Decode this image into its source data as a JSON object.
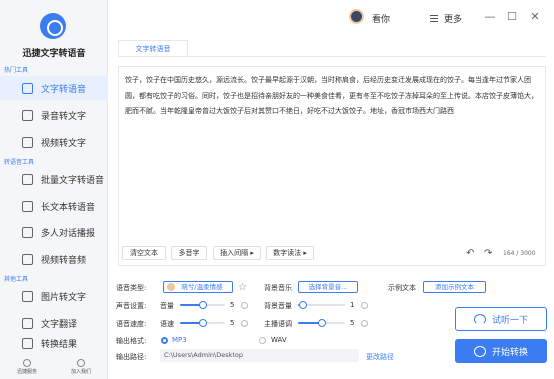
{
  "app": {
    "name": "迅捷文字转语音"
  },
  "sidebar": {
    "groups": [
      {
        "label": "热门工具"
      },
      {
        "label": "转语音工具"
      },
      {
        "label": "其他工具"
      }
    ],
    "items": [
      {
        "label": "文字转语音"
      },
      {
        "label": "录音转文字"
      },
      {
        "label": "视频转文字"
      },
      {
        "label": "批量文字转语音"
      },
      {
        "label": "长文本转语音"
      },
      {
        "label": "多人对话播报"
      },
      {
        "label": "视频转音频"
      },
      {
        "label": "图片转文字"
      },
      {
        "label": "文字翻译"
      },
      {
        "label": "转换结果"
      }
    ],
    "bottom": [
      {
        "label": "迅捷服务"
      },
      {
        "label": "加入我们"
      }
    ]
  },
  "header": {
    "username": "看你",
    "more_label": "更多"
  },
  "editor": {
    "tab": "文字转语音",
    "text": "饺子，饺子在中国历史悠久，源远流长。饺子最早起源于汉朝，当时称肩食，后经历史变迁发展成现在的饺子。每当逢年过节家人团圆，都有吃饺子的习俗。同时，饺子也是招待亲朋好友的一种美食佳肴，更有冬至不吃饺子冻掉耳朵的至上传说。本店饺子皮薄馅大，肥而不腻。当年乾隆皇帝曾过大饭饺子后对其赞口不绝日，好吃不过大饭饺子。地址，香冠市场西大门路西",
    "buttons": [
      "清空文本",
      "多音字",
      "插入间隔 ▸",
      "数字读法 ▸"
    ],
    "count": "164 / 3000"
  },
  "settings": {
    "voice_type_label": "语音类型:",
    "voice_name": "晓兮/温柔情感",
    "bgm_label": "背景音乐",
    "bgm_button": "选择背景音...",
    "sample_label": "示例文本",
    "sample_button": "添加示例文本",
    "volume_label": "声音设置:",
    "volume_name": "音量",
    "volume_value": 5,
    "bgm_volume_name": "背景音量",
    "bgm_volume_value": 1,
    "speed_label": "语音速度:",
    "speed_name": "语速",
    "speed_value": 5,
    "pitch_name": "主播语调",
    "pitch_value": 5,
    "slider_max": 10,
    "format_label": "输出格式:",
    "format_mp3": "MP3",
    "format_wav": "WAV",
    "format_selected": "MP3",
    "path_label": "输出路径:",
    "path_value": "C:\\Users\\Admin\\Desktop",
    "change_path": "更改路径"
  },
  "actions": {
    "listen": "试听一下",
    "start": "开始转换"
  },
  "colors": {
    "accent": "#3b7cf3",
    "sidebar_bg": "#f5f6f8"
  }
}
